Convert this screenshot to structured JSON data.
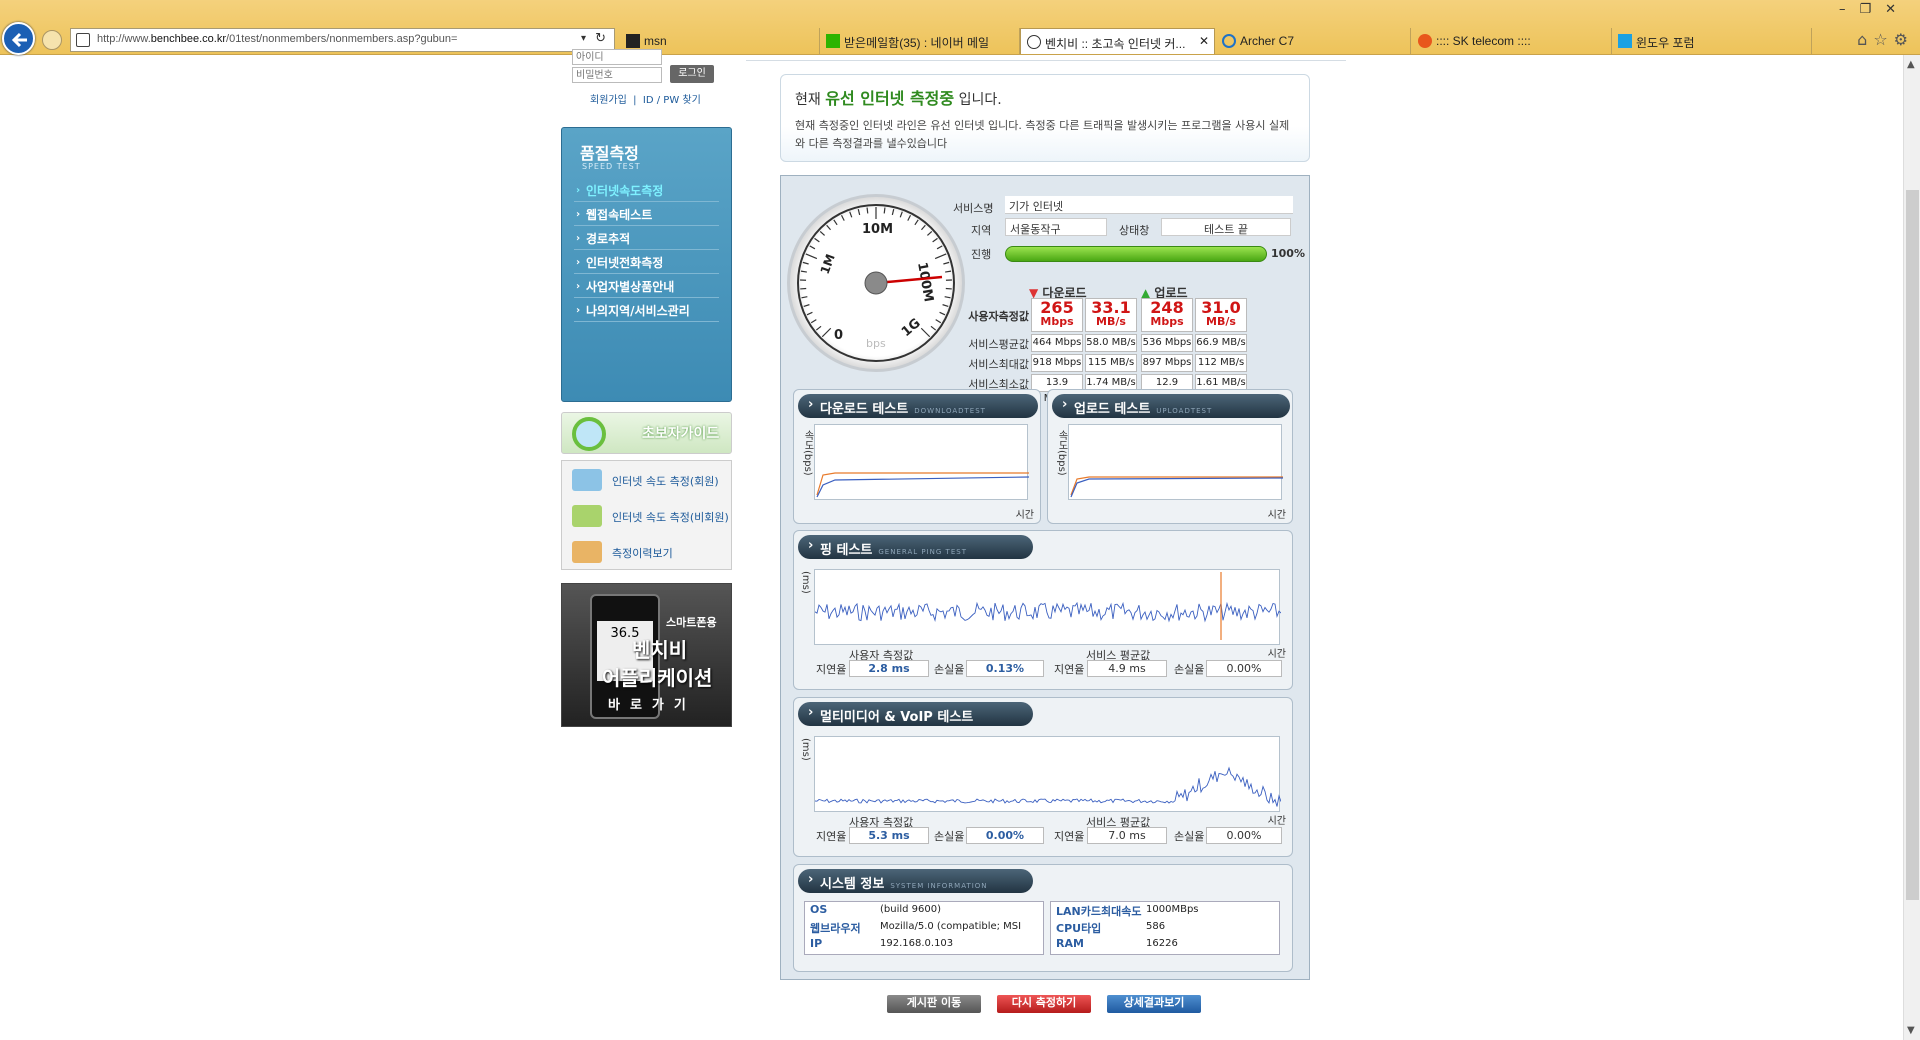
{
  "browser": {
    "url_pre": "http://www.",
    "url_host": "benchbee.co.kr",
    "url_post": "/01test/nonmembers/nonmembers.asp?gubun=",
    "tabs": [
      {
        "label": "msn"
      },
      {
        "label": "받은메일함(35) : 네이버 메일"
      },
      {
        "label": "벤치비 :: 초고속 인터넷 커..."
      },
      {
        "label": "Archer C7"
      },
      {
        "label": ":::: SK telecom ::::"
      },
      {
        "label": "윈도우 포럼"
      }
    ]
  },
  "login": {
    "id_placeholder": "아이디",
    "pw_placeholder": "비밀번호",
    "login_button": "로그인",
    "join": "회원가입",
    "find": "ID / PW 찾기"
  },
  "sidenav": {
    "title": "품질측정",
    "subtitle": "SPEED TEST",
    "items": [
      "인터넷속도측정",
      "웹접속테스트",
      "경로추적",
      "인터넷전화측정",
      "사업자별상품안내",
      "나의지역/서비스관리"
    ]
  },
  "guide": {
    "label": "초보자가이드"
  },
  "quick_links": [
    "인터넷 속도 측정(회원)",
    "인터넷 속도 측정(비회원)",
    "측정이력보기"
  ],
  "app_banner": {
    "line1": "스마트폰용",
    "line2": "벤치비",
    "line3": "어플리케이션",
    "line4": "바로가기",
    "phone_value": "36.5"
  },
  "notice": {
    "prefix": "현재",
    "highlight": "유선 인터넷 측정중",
    "suffix": "입니다.",
    "desc": "현재 측정중인 인터넷 라인은 유선 인터넷 입니다. 측정중 다른 트래픽을 발생시키는 프로그램을 사용시 실제와 다른 측정결과를 낼수있습니다"
  },
  "gauge": {
    "labels": [
      "0",
      "1M",
      "10M",
      "100M",
      "1G"
    ],
    "unit": "bps"
  },
  "service": {
    "name_label": "서비스명",
    "name_value": "기가 인터넷",
    "region_label": "지역",
    "region_value": "서울동작구",
    "status_label": "상태창",
    "status_value": "테스트 끝",
    "progress_label": "진행",
    "progress_pct": "100%",
    "progress_fraction": 1.0
  },
  "results": {
    "download_label": "다운로드",
    "upload_label": "업로드",
    "row_labels": [
      "사용자측정값",
      "서비스평균값",
      "서비스최대값",
      "서비스최소값"
    ],
    "user": {
      "down_mbps": "265",
      "down_mbs": "33.1",
      "up_mbps": "248",
      "up_mbs": "31.0",
      "unit_mbps": "Mbps",
      "unit_mbs": "MB/s"
    },
    "rows": [
      [
        "464 Mbps",
        "58.0 MB/s",
        "536 Mbps",
        "66.9 MB/s"
      ],
      [
        "918 Mbps",
        "115 MB/s",
        "897 Mbps",
        "112 MB/s"
      ],
      [
        "13.9 Mbps",
        "1.74 MB/s",
        "12.9 Mbps",
        "1.61 MB/s"
      ]
    ]
  },
  "download_test": {
    "title": "다운로드 테스트",
    "subtitle": "DOWNLOADTEST",
    "ylabel": "속도(bps)",
    "xlabel": "시간"
  },
  "upload_test": {
    "title": "업로드 테스트",
    "subtitle": "UPLOADTEST",
    "ylabel": "속도(bps)",
    "xlabel": "시간"
  },
  "ping_test": {
    "title": "핑 테스트",
    "subtitle": "GENERAL PING TEST",
    "ylabel": "(ms)",
    "xlabel": "시간",
    "user_label": "사용자 측정값",
    "avg_label": "서비스 평균값",
    "latency_label": "지연율",
    "loss_label": "손실율",
    "user_latency": "2.8 ms",
    "user_loss": "0.13%",
    "avg_latency": "4.9 ms",
    "avg_loss": "0.00%"
  },
  "voip_test": {
    "title": "멀티미디어 & VoIP 테스트",
    "ylabel": "(ms)",
    "xlabel": "시간",
    "user_label": "사용자 측정값",
    "avg_label": "서비스 평균값",
    "latency_label": "지연율",
    "loss_label": "손실율",
    "user_latency": "5.3 ms",
    "user_loss": "0.00%",
    "avg_latency": "7.0 ms",
    "avg_loss": "0.00%"
  },
  "system": {
    "title": "시스템 정보",
    "subtitle": "SYSTEM INFORMATION",
    "os_label": "OS",
    "os_value": "(build 9600)",
    "browser_label": "웹브라우저",
    "browser_value": "Mozilla/5.0 (compatible; MSI",
    "ip_label": "IP",
    "ip_value": "192.168.0.103",
    "lan_label": "LAN카드최대속도",
    "lan_value": "1000MBps",
    "cpu_label": "CPU타입",
    "cpu_value": "586",
    "ram_label": "RAM",
    "ram_value": "16226"
  },
  "buttons": {
    "board": "게시판 이동",
    "retest": "다시 측정하기",
    "detail": "상세결과보기"
  },
  "colors": {
    "accent_red": "#d01515",
    "progress_green": "#4aa713",
    "nav_blue": "#3d8bb4"
  }
}
